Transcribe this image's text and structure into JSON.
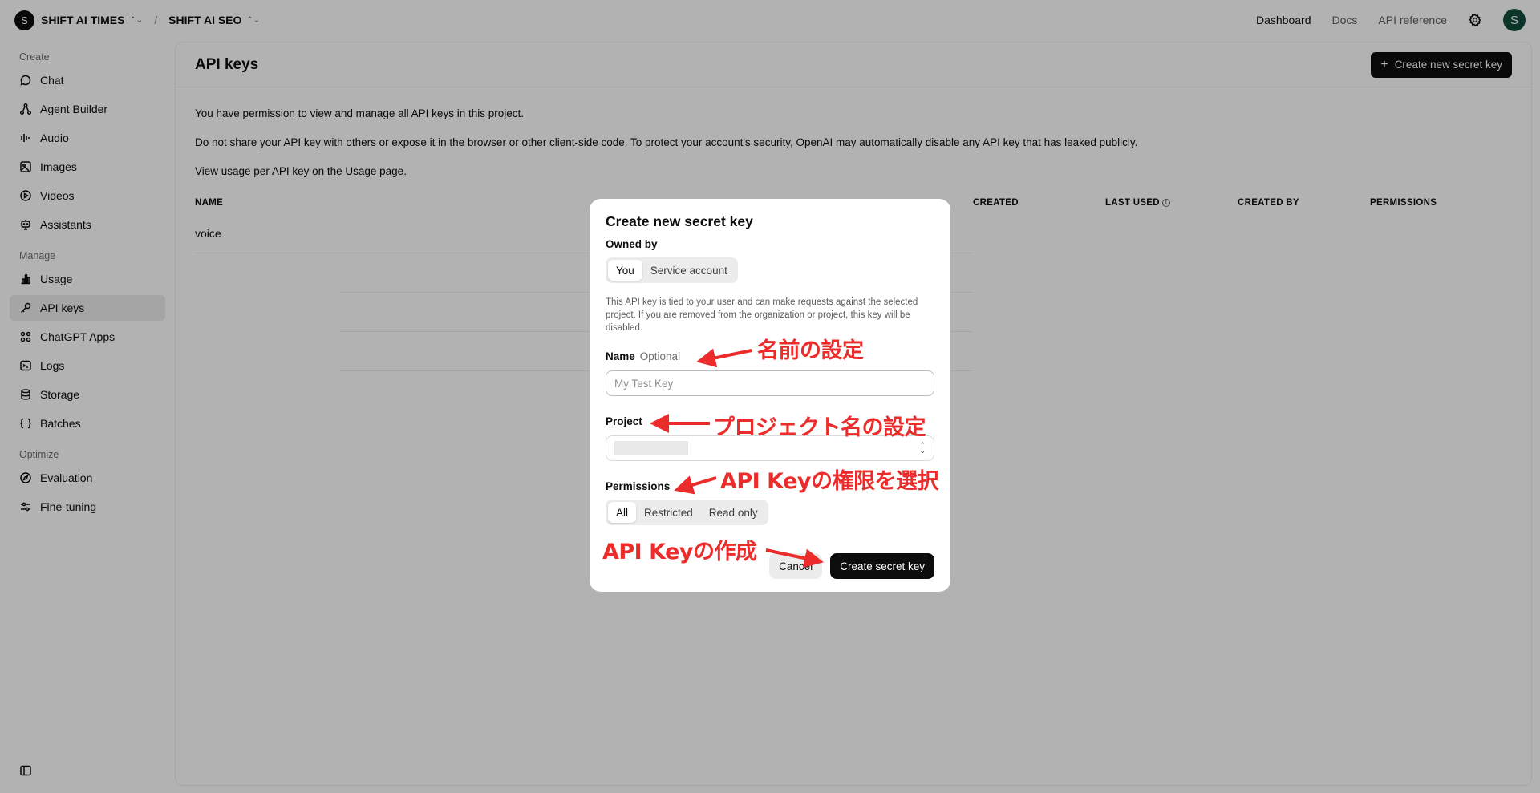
{
  "topbar": {
    "org_initial": "S",
    "org_name": "SHIFT AI TIMES",
    "project_name": "SHIFT AI SEO",
    "nav": [
      "Dashboard",
      "Docs",
      "API reference"
    ],
    "user_initial": "S"
  },
  "sidebar": {
    "sections": [
      {
        "label": "Create",
        "items": [
          {
            "label": "Chat",
            "icon": "chat-bubble-icon"
          },
          {
            "label": "Agent Builder",
            "icon": "agent-icon"
          },
          {
            "label": "Audio",
            "icon": "waveform-icon"
          },
          {
            "label": "Images",
            "icon": "image-icon"
          },
          {
            "label": "Videos",
            "icon": "play-icon"
          },
          {
            "label": "Assistants",
            "icon": "robot-icon"
          }
        ]
      },
      {
        "label": "Manage",
        "items": [
          {
            "label": "Usage",
            "icon": "bar-chart-icon"
          },
          {
            "label": "API keys",
            "icon": "key-icon",
            "selected": true
          },
          {
            "label": "ChatGPT Apps",
            "icon": "apps-icon"
          },
          {
            "label": "Logs",
            "icon": "terminal-icon"
          },
          {
            "label": "Storage",
            "icon": "database-icon"
          },
          {
            "label": "Batches",
            "icon": "braces-icon"
          }
        ]
      },
      {
        "label": "Optimize",
        "items": [
          {
            "label": "Evaluation",
            "icon": "compass-icon"
          },
          {
            "label": "Fine-tuning",
            "icon": "sliders-icon"
          }
        ]
      }
    ]
  },
  "main": {
    "title": "API keys",
    "create_button": "Create new secret key",
    "info": {
      "line1": "You have permission to view and manage all API keys in this project.",
      "line2": "Do not share your API key with others or expose it in the browser or other client-side code. To protect your account's security, OpenAI may automatically disable any API key that has leaked publicly.",
      "line3_prefix": "View usage per API key on the ",
      "line3_link": "Usage page",
      "line3_suffix": "."
    },
    "table": {
      "columns": [
        "NAME",
        "CREATED",
        "LAST USED",
        "CREATED BY",
        "PERMISSIONS"
      ],
      "rows": [
        {
          "name": "voice"
        }
      ]
    }
  },
  "modal": {
    "title": "Create new secret key",
    "owned_by_label": "Owned by",
    "owner_options": [
      "You",
      "Service account"
    ],
    "owner_selected": "You",
    "note": "This API key is tied to your user and can make requests against the selected project. If you are removed from the organization or project, this key will be disabled.",
    "name_label": "Name",
    "name_optional": "Optional",
    "name_placeholder": "My Test Key",
    "project_label": "Project",
    "permissions_label": "Permissions",
    "permission_options": [
      "All",
      "Restricted",
      "Read only"
    ],
    "permission_selected": "All",
    "cancel": "Cancel",
    "submit": "Create secret key"
  },
  "annotations": {
    "name": "名前の設定",
    "project": "プロジェクト名の設定",
    "permissions": "API Keyの権限を選択",
    "create": "API Keyの作成",
    "color": "#ec2b2b"
  }
}
